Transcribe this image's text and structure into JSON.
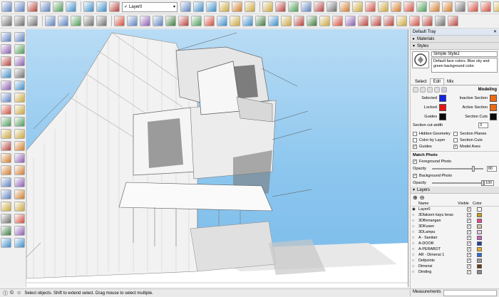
{
  "toolbar": {
    "layer_combo_value": "Layer0",
    "row1_icons": [
      "select-icon",
      "rectangle-icon",
      "circle-icon",
      "group-icon",
      "component-icon",
      "paint-icon",
      "move-icon",
      "push-pull-icon",
      "scale-icon",
      "walk-icon",
      "rotate-icon",
      "orbit-icon",
      "pan-icon",
      "zoom-icon",
      "zoom-extents-icon",
      "styles-icon",
      "xray-icon",
      "back-edges-icon",
      "wireframe-icon",
      "hidden-line-icon",
      "shaded-icon",
      "textured-icon",
      "monochrome-icon",
      "iso-view-icon",
      "top-view-icon",
      "front-view-icon"
    ],
    "row1_right_icons": [
      "warehouse-icon",
      "extension-icon",
      "send-layout-icon",
      "section-plane-icon",
      "section-display-icon",
      "section-cut-icon",
      "paint-bucket-icon",
      "color-wheel-icon",
      "colors-icon",
      "display-icon",
      "measure-icon",
      "export-icon",
      "component-3d-icon",
      "camera-icon",
      "pencil-icon",
      "shadow-icon",
      "fog-icon",
      "styles-icon",
      "print-icon"
    ],
    "row2_icons": [
      "layer-manager-icon",
      "layers-icon",
      "section-fill-icon",
      "solid-union-icon",
      "solid-subtract-icon",
      "solid-trim-icon",
      "solid-intersect-icon",
      "solid-split-icon",
      "curic-icon",
      "sandbox-icon",
      "drape-icon",
      "stamp-icon",
      "flip-icon",
      "smoove-icon",
      "add-detail-icon",
      "flip-edge-icon",
      "extrude-icon",
      "follow-me-icon",
      "offset-icon",
      "arc-icon",
      "soften-icon",
      "fillet-icon",
      "chamfer-icon",
      "round-corner-icon",
      "loft-icon",
      "skin-icon",
      "weld-icon",
      "joint-push-icon",
      "vertex-icon",
      "subdivide-icon",
      "bezier-icon",
      "spline-icon",
      "polyline-icon",
      "catmull-icon",
      "nurbs-icon",
      "fredo-scale-icon",
      "twist-icon",
      "shear-icon",
      "taper-icon",
      "bend-icon"
    ]
  },
  "left_tools": [
    "select-icon",
    "component-icon",
    "eraser-icon",
    "paint-icon",
    "line-icon",
    "freehand-icon",
    "rectangle-icon",
    "rotated-rect-icon",
    "circle-icon",
    "polygon-icon",
    "arc-icon",
    "two-point-arc-icon",
    "three-point-arc-icon",
    "pie-icon",
    "move-icon",
    "push-pull-icon",
    "rotate-icon",
    "follow-me-icon",
    "scale-icon",
    "offset-icon",
    "tape-icon",
    "text-icon",
    "protractor-icon",
    "axes-icon",
    "dimension-icon",
    "3d-text-icon",
    "orbit-icon",
    "pan-icon",
    "zoom-icon",
    "zoom-window-icon",
    "zoom-extents-icon",
    "previous-view-icon",
    "position-camera-icon",
    "walk-icon",
    "look-around-icon",
    "section-plane-icon"
  ],
  "tray": {
    "title": "Default Tray",
    "materials_label": "Materials",
    "styles_label": "Styles",
    "style_name": "Simple Style2",
    "style_description": "Default face colors. Blue sky and green background color.",
    "tabs": [
      "Select",
      "Edit",
      "Mix"
    ],
    "active_tab": "Edit",
    "modeling_label": "Modeling",
    "colors": [
      {
        "label": "Selected",
        "color": "#1222e6",
        "label2": "Inactive Section",
        "color2": "#f06a10"
      },
      {
        "label": "Locked",
        "color": "#e81414",
        "label2": "Active Section",
        "color2": "#f06a10"
      },
      {
        "label": "Guides",
        "color": "#0a0a0a",
        "label2": "Section Cuts",
        "color2": "#0a0a0a"
      }
    ],
    "section_cut_width_label": "Section cut width",
    "section_cut_width_value": "3",
    "checks": [
      {
        "label": "Hidden Geometry",
        "checked": false,
        "label2": "Section Planes",
        "checked2": false
      },
      {
        "label": "Color by Layer",
        "checked": false,
        "label2": "Section Cuts",
        "checked2": false
      },
      {
        "label": "Guides",
        "checked": true,
        "label2": "Model Axes",
        "checked2": true
      }
    ],
    "match_photo_label": "Match Photo",
    "foreground_photo_label": "Foreground Photo",
    "opacity_label": "Opacity",
    "foreground_opacity": "80",
    "background_photo_label": "Background Photo",
    "background_opacity": "100",
    "layers_label": "Layers",
    "layers_columns": {
      "name": "Name",
      "visible": "Visible",
      "color": "Color"
    },
    "layers": [
      {
        "name": "Layer0",
        "active": true,
        "color": "#ffffff"
      },
      {
        "name": "3Dlaksen kayu teras",
        "active": false,
        "color": "#c8a010"
      },
      {
        "name": "3DBenangan",
        "active": false,
        "color": "#ee4488"
      },
      {
        "name": "3DKusen",
        "active": false,
        "color": "#d8c0a0"
      },
      {
        "name": "3DLampu",
        "active": false,
        "color": "#e6c8e6"
      },
      {
        "name": "A - Sanitair",
        "active": false,
        "color": "#d060c0"
      },
      {
        "name": "A-DOOR",
        "active": false,
        "color": "#2040a0"
      },
      {
        "name": "A-PERABOT",
        "active": false,
        "color": "#e8b020"
      },
      {
        "name": "AR - Dimensi 1",
        "active": false,
        "color": "#2070d8"
      },
      {
        "name": "Defpoints",
        "active": false,
        "color": "#9a9a9a"
      },
      {
        "name": "Dimensi",
        "active": false,
        "color": "#6a3a10"
      },
      {
        "name": "Dinding",
        "active": false,
        "color": "#8a8a8a"
      }
    ]
  },
  "status": {
    "message": "Select objects. Shift to extend select. Drag mouse to select multiple.",
    "measurements_label": "Measurements"
  }
}
